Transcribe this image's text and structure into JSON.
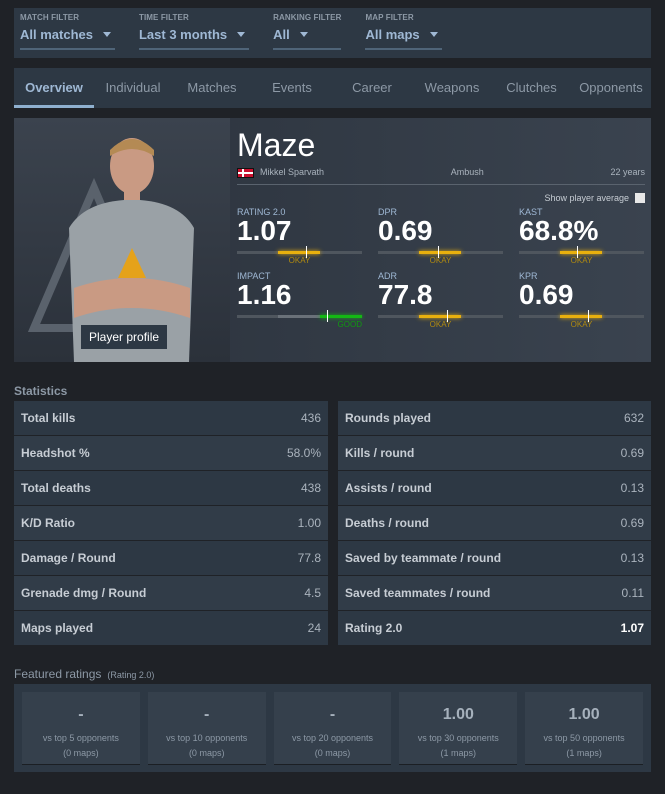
{
  "filters": [
    {
      "label": "MATCH FILTER",
      "value": "All matches"
    },
    {
      "label": "TIME FILTER",
      "value": "Last 3 months"
    },
    {
      "label": "RANKING FILTER",
      "value": "All"
    },
    {
      "label": "MAP FILTER",
      "value": "All maps"
    }
  ],
  "tabs": [
    "Overview",
    "Individual",
    "Matches",
    "Events",
    "Career",
    "Weapons",
    "Clutches",
    "Opponents"
  ],
  "active_tab": "Overview",
  "player": {
    "nickname": "Maze",
    "real_name": "Mikkel Sparvath",
    "country": "Denmark",
    "team": "Ambush",
    "age": "22 years",
    "profile_button": "Player profile",
    "show_average_label": "Show player average",
    "show_average_checked": false
  },
  "colors": {
    "okay": "#e8b00e",
    "good": "#14b814",
    "accent": "#9fb8d4"
  },
  "stats_summary": [
    {
      "key": "RATING 2.0",
      "value": "1.07",
      "verdict": "OKAY",
      "marker": 0.55
    },
    {
      "key": "DPR",
      "value": "0.69",
      "verdict": "OKAY",
      "marker": 0.48
    },
    {
      "key": "KAST",
      "value": "68.8%",
      "verdict": "OKAY",
      "marker": 0.46
    },
    {
      "key": "IMPACT",
      "value": "1.16",
      "verdict": "GOOD",
      "marker": 0.72
    },
    {
      "key": "ADR",
      "value": "77.8",
      "verdict": "OKAY",
      "marker": 0.55
    },
    {
      "key": "KPR",
      "value": "0.69",
      "verdict": "OKAY",
      "marker": 0.55
    }
  ],
  "statistics_title": "Statistics",
  "statistics_left": [
    [
      "Total kills",
      "436"
    ],
    [
      "Headshot %",
      "58.0%"
    ],
    [
      "Total deaths",
      "438"
    ],
    [
      "K/D Ratio",
      "1.00"
    ],
    [
      "Damage / Round",
      "77.8"
    ],
    [
      "Grenade dmg / Round",
      "4.5"
    ],
    [
      "Maps played",
      "24"
    ]
  ],
  "statistics_right": [
    [
      "Rounds played",
      "632"
    ],
    [
      "Kills / round",
      "0.69"
    ],
    [
      "Assists / round",
      "0.13"
    ],
    [
      "Deaths / round",
      "0.69"
    ],
    [
      "Saved by teammate / round",
      "0.13"
    ],
    [
      "Saved teammates / round",
      "0.11"
    ],
    [
      "Rating 2.0",
      "1.07"
    ]
  ],
  "featured": {
    "title": "Featured ratings",
    "subtitle": "(Rating 2.0)",
    "cards": [
      {
        "rating": "-",
        "label": "vs top 5 opponents",
        "maps": "(0 maps)"
      },
      {
        "rating": "-",
        "label": "vs top 10 opponents",
        "maps": "(0 maps)"
      },
      {
        "rating": "-",
        "label": "vs top 20 opponents",
        "maps": "(0 maps)"
      },
      {
        "rating": "1.00",
        "label": "vs top 30 opponents",
        "maps": "(1 maps)"
      },
      {
        "rating": "1.00",
        "label": "vs top 50 opponents",
        "maps": "(1 maps)"
      }
    ]
  }
}
